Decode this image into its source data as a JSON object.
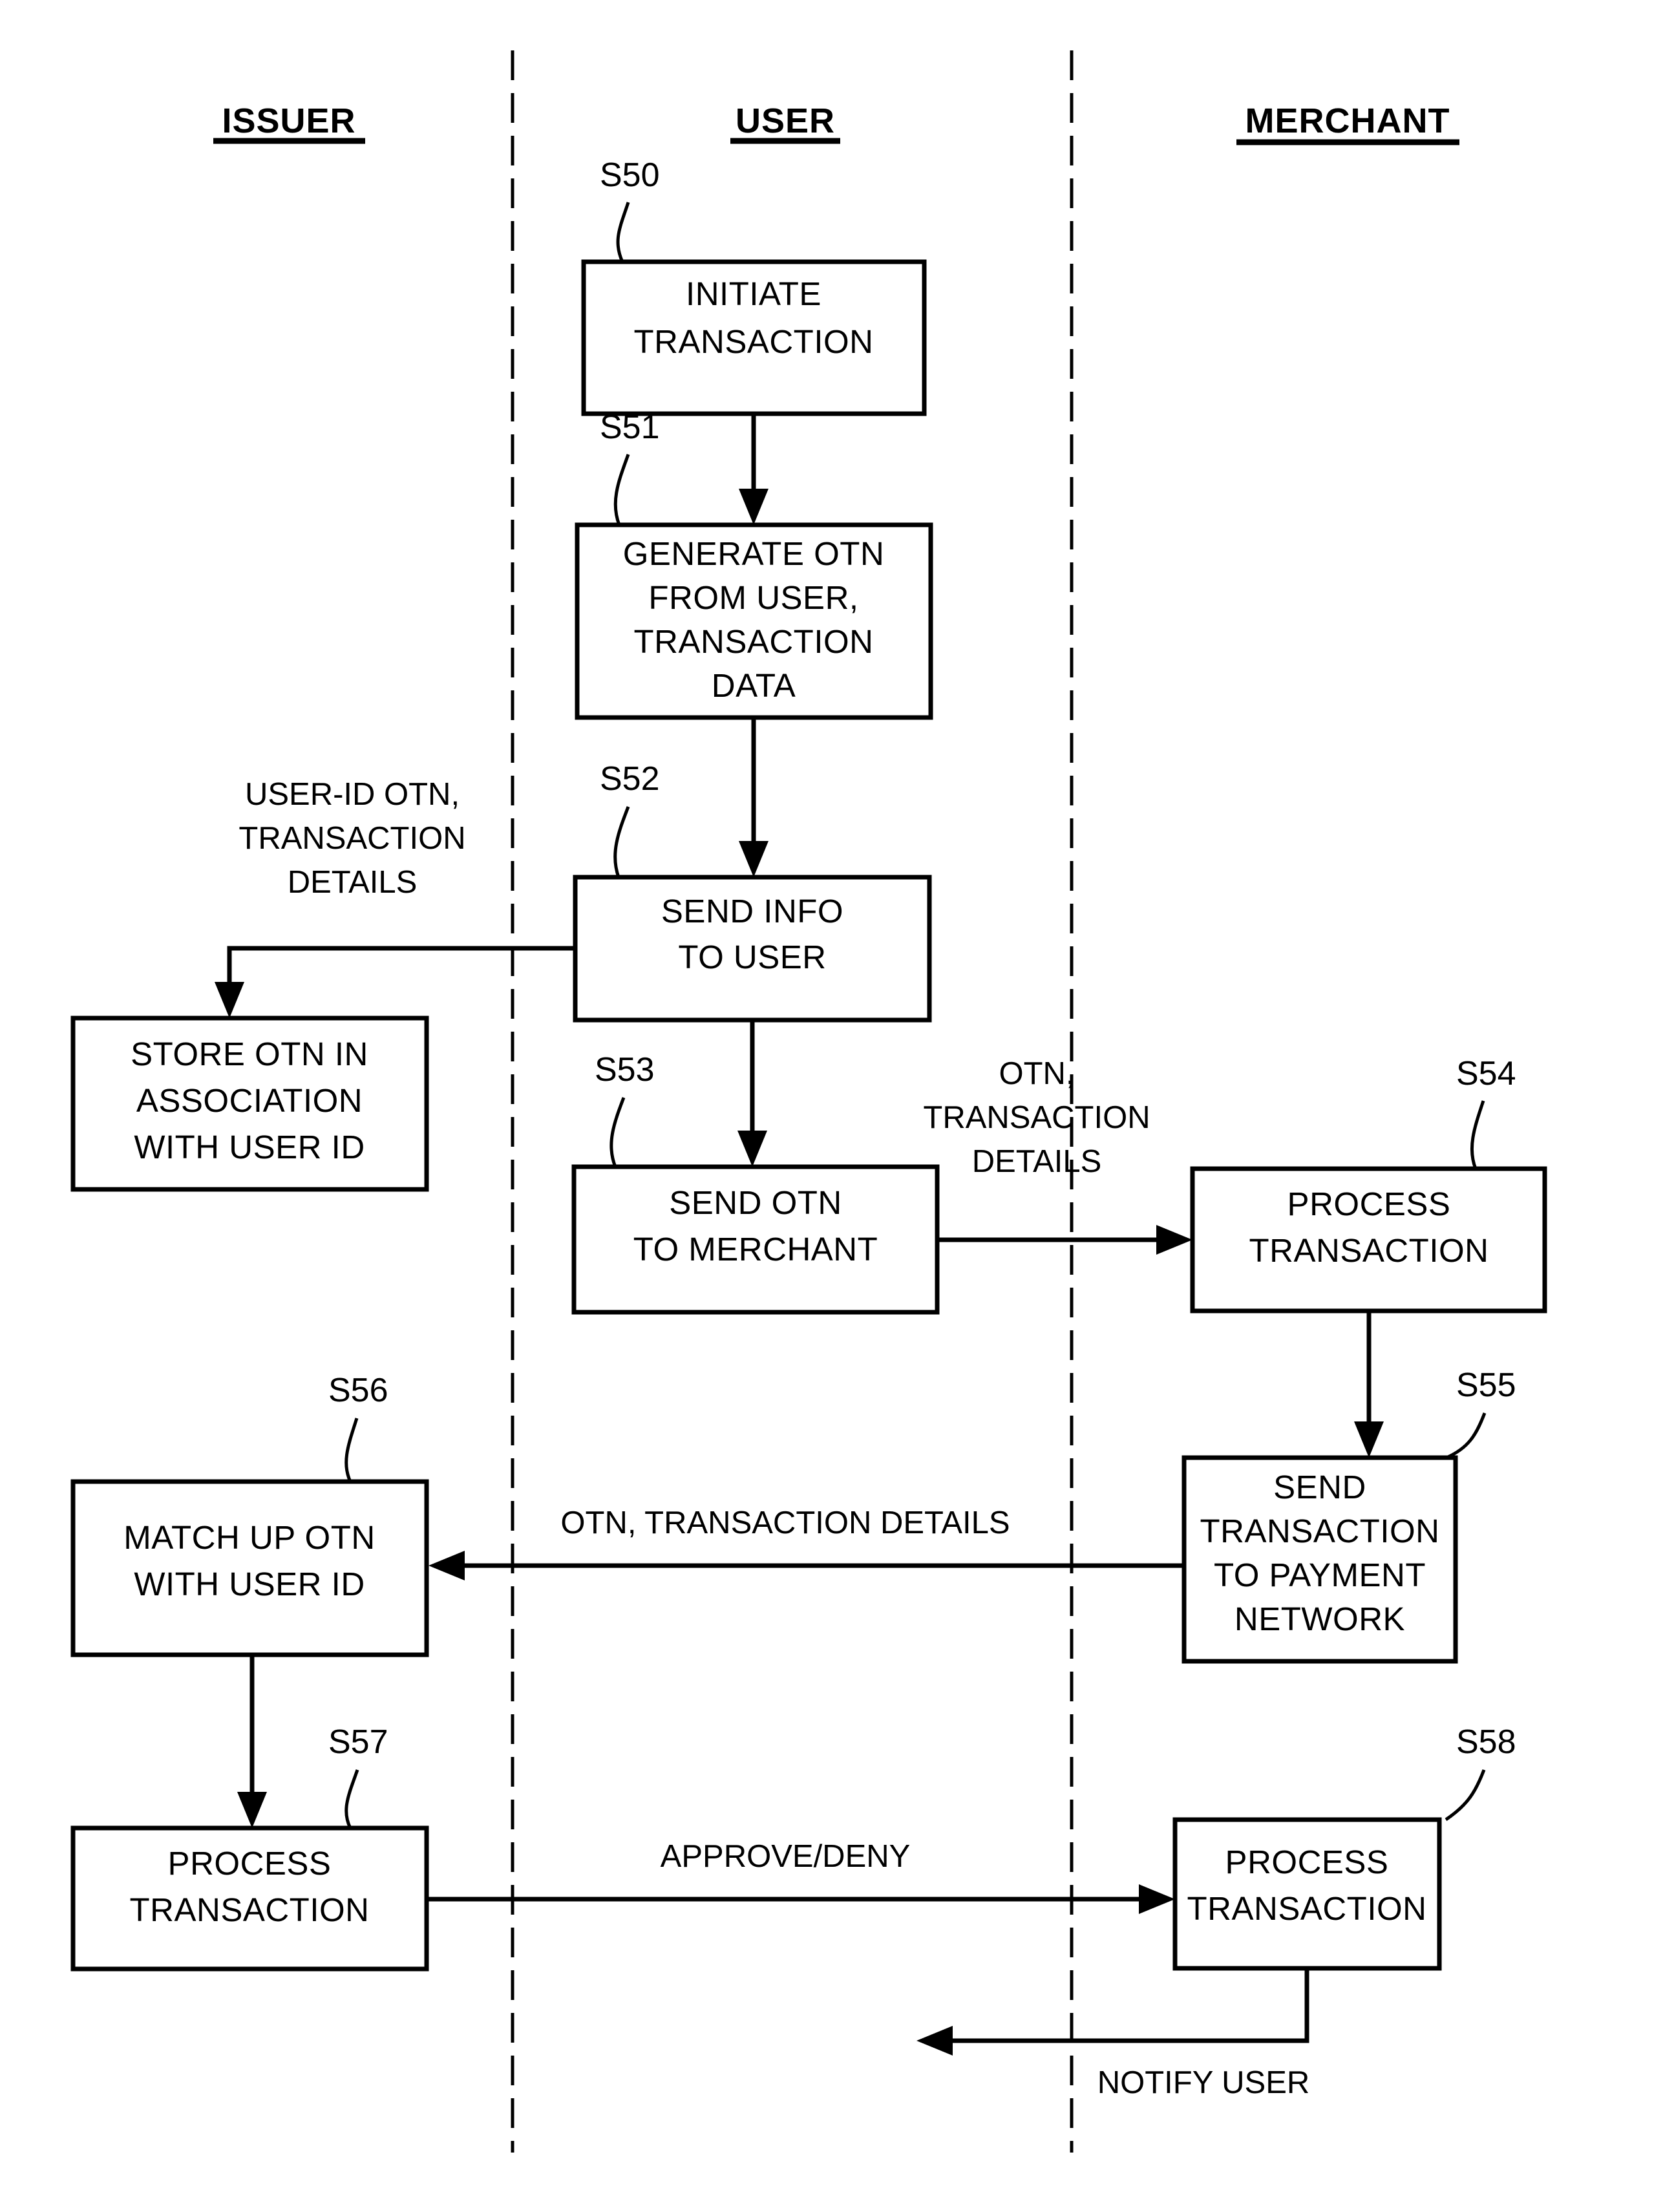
{
  "figure": {
    "kind": "patent-flowchart",
    "background": "#ffffff",
    "ink": "#000000"
  },
  "lanes": [
    {
      "id": "issuer",
      "title": "ISSUER"
    },
    {
      "id": "user",
      "title": "USER"
    },
    {
      "id": "merchant",
      "title": "MERCHANT"
    }
  ],
  "steps": {
    "s50": {
      "tag": "S50",
      "line1": "INITIATE",
      "line2": "TRANSACTION"
    },
    "s51": {
      "tag": "S51",
      "line1": "GENERATE OTN",
      "line2": "FROM USER,",
      "line3": "TRANSACTION",
      "line4": "DATA"
    },
    "s52": {
      "tag": "S52",
      "line1": "SEND INFO",
      "line2": "TO USER"
    },
    "s53": {
      "tag": "S53",
      "line1": "SEND OTN",
      "line2": "TO MERCHANT"
    },
    "s54": {
      "tag": "S54",
      "line1": "PROCESS",
      "line2": "TRANSACTION"
    },
    "s55": {
      "tag": "S55",
      "line1": "SEND",
      "line2": "TRANSACTION",
      "line3": "TO PAYMENT",
      "line4": "NETWORK"
    },
    "s56": {
      "tag": "S56",
      "line1": "MATCH UP OTN",
      "line2": "WITH USER ID"
    },
    "s57": {
      "tag": "S57",
      "line1": "PROCESS",
      "line2": "TRANSACTION"
    },
    "s58": {
      "tag": "S58",
      "line1": "PROCESS",
      "line2": "TRANSACTION"
    },
    "store": {
      "line1": "STORE OTN IN",
      "line2": "ASSOCIATION",
      "line3": "WITH USER ID"
    }
  },
  "edge_labels": {
    "user_to_issuer_l1": "USER-ID OTN,",
    "user_to_issuer_l2": "TRANSACTION",
    "user_to_issuer_l3": "DETAILS",
    "user_to_merchant_l1": "OTN,",
    "user_to_merchant_l2": "TRANSACTION",
    "user_to_merchant_l3": "DETAILS",
    "merchant_to_issuer": "OTN, TRANSACTION DETAILS",
    "issuer_to_merchant": "APPROVE/DENY",
    "merchant_notify": "NOTIFY USER"
  },
  "chart_data": {
    "type": "diagram",
    "title": "Payment transaction flow between Issuer, User and Merchant",
    "lanes": [
      "ISSUER",
      "USER",
      "MERCHANT"
    ],
    "nodes": [
      {
        "id": "S50",
        "lane": "USER",
        "label": "INITIATE TRANSACTION"
      },
      {
        "id": "S51",
        "lane": "USER",
        "label": "GENERATE OTN FROM USER, TRANSACTION DATA"
      },
      {
        "id": "S52",
        "lane": "USER",
        "label": "SEND INFO TO USER"
      },
      {
        "id": "S53",
        "lane": "USER",
        "label": "SEND OTN TO MERCHANT"
      },
      {
        "id": "STORE",
        "lane": "ISSUER",
        "label": "STORE OTN IN ASSOCIATION WITH USER ID"
      },
      {
        "id": "S54",
        "lane": "MERCHANT",
        "label": "PROCESS TRANSACTION"
      },
      {
        "id": "S55",
        "lane": "MERCHANT",
        "label": "SEND TRANSACTION TO PAYMENT NETWORK"
      },
      {
        "id": "S56",
        "lane": "ISSUER",
        "label": "MATCH UP OTN WITH USER ID"
      },
      {
        "id": "S57",
        "lane": "ISSUER",
        "label": "PROCESS TRANSACTION"
      },
      {
        "id": "S58",
        "lane": "MERCHANT",
        "label": "PROCESS TRANSACTION"
      }
    ],
    "edges": [
      {
        "from": "S50",
        "to": "S51",
        "label": ""
      },
      {
        "from": "S51",
        "to": "S52",
        "label": ""
      },
      {
        "from": "S52",
        "to": "STORE",
        "label": "USER-ID OTN, TRANSACTION DETAILS"
      },
      {
        "from": "S52",
        "to": "S53",
        "label": ""
      },
      {
        "from": "S53",
        "to": "S54",
        "label": "OTN, TRANSACTION DETAILS"
      },
      {
        "from": "S54",
        "to": "S55",
        "label": ""
      },
      {
        "from": "S55",
        "to": "S56",
        "label": "OTN, TRANSACTION DETAILS"
      },
      {
        "from": "S56",
        "to": "S57",
        "label": ""
      },
      {
        "from": "S57",
        "to": "S58",
        "label": "APPROVE/DENY"
      },
      {
        "from": "S58",
        "to": "USER",
        "label": "NOTIFY USER"
      }
    ]
  }
}
